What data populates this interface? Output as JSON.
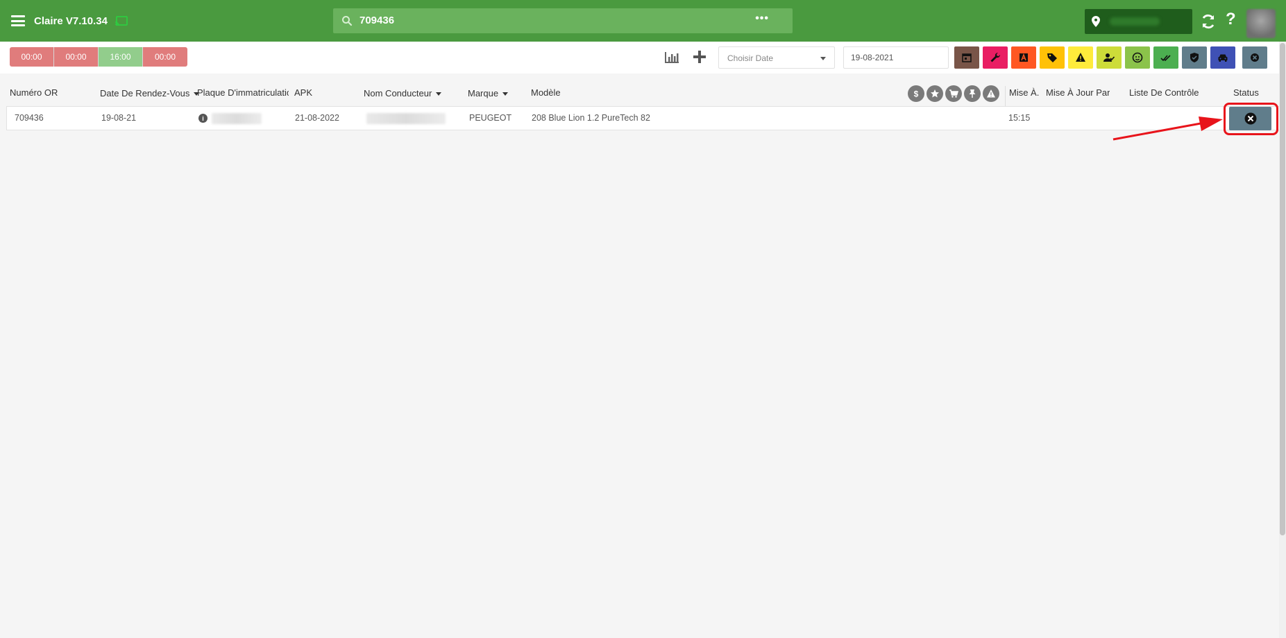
{
  "app": {
    "title": "Claire V7.10.34"
  },
  "search": {
    "value": "709436",
    "more_label": "•••"
  },
  "help_label": "?",
  "toolbar": {
    "time_slots": [
      {
        "label": "00:00",
        "color": "#e07c7c"
      },
      {
        "label": "00:00",
        "color": "#e07c7c"
      },
      {
        "label": "16:00",
        "color": "#92cd8c"
      },
      {
        "label": "00:00",
        "color": "#e07c7c"
      }
    ],
    "date_select_label": "Choisir Date",
    "date_value": "19-08-2021",
    "filters": [
      {
        "name": "calendar-filter",
        "color": "#795548"
      },
      {
        "name": "wrench-filter",
        "color": "#e91e63"
      },
      {
        "name": "letter-a-filter",
        "color": "#ff5722"
      },
      {
        "name": "tag-filter",
        "color": "#ffc107"
      },
      {
        "name": "warning-filter",
        "color": "#ffeb3b"
      },
      {
        "name": "user-check-filter",
        "color": "#cddc39"
      },
      {
        "name": "face-filter",
        "color": "#8bc34a"
      },
      {
        "name": "double-check-filter",
        "color": "#4caf50"
      },
      {
        "name": "shield-filter",
        "color": "#607d8b"
      },
      {
        "name": "car-filter",
        "color": "#3f51b5"
      },
      {
        "name": "cancel-filter",
        "color": "#607d8b"
      }
    ]
  },
  "table": {
    "headers": {
      "numero_or": "Numéro OR",
      "date_rdv": "Date De Rendez-Vous",
      "plaque": "Plaque D'immatriculation",
      "apk": "APK",
      "nom_conducteur": "Nom Conducteur",
      "marque": "Marque",
      "modele": "Modèle",
      "mise_a": "Mise À...",
      "mise_a_jour_par": "Mise À Jour Par",
      "liste_controle": "Liste De Contrôle",
      "status": "Status"
    },
    "header_icons": [
      "dollar-icon",
      "star-icon",
      "cart-icon",
      "pin-icon",
      "warning-icon"
    ],
    "rows": [
      {
        "numero_or": "709436",
        "date_rdv": "19-08-21",
        "apk": "21-08-2022",
        "marque": "PEUGEOT",
        "modele": "208 Blue Lion 1.2 PureTech 82",
        "mise_a": "15:15"
      }
    ]
  },
  "colors": {
    "topbar": "#4a9a3f",
    "highlight": "#e8141b",
    "status_button": "#607d8b"
  }
}
